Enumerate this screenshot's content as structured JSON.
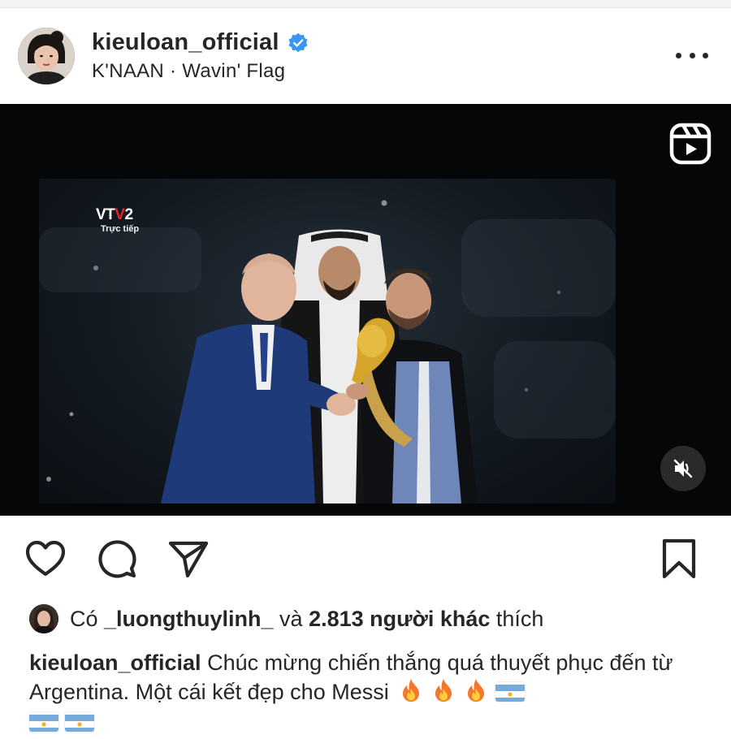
{
  "post": {
    "username": "kieuloan_official",
    "music": "K'NAAN · Wavin'  Flag",
    "verified": true
  },
  "media": {
    "tv_logo_prefix": "VT",
    "tv_logo_v": "V",
    "tv_logo_num": "2",
    "tv_subtitle": "Trực tiếp",
    "muted": true
  },
  "likes": {
    "prefix": "Có ",
    "user": "_luongthuylinh_",
    "middle": " và ",
    "count": "2.813 người khác",
    "suffix": " thích"
  },
  "caption": {
    "user": "kieuloan_official",
    "text": " Chúc mừng chiến thắng quá thuyết phục đến từ Argentina. Một cái kết đẹp cho Messi"
  },
  "icons": {
    "verified_color": "#3897f0",
    "fire_count": 3,
    "flag_count": 3
  },
  "colors": {
    "text": "#262626",
    "media_bg": "#050608",
    "accent_blue": "#3897f0"
  }
}
